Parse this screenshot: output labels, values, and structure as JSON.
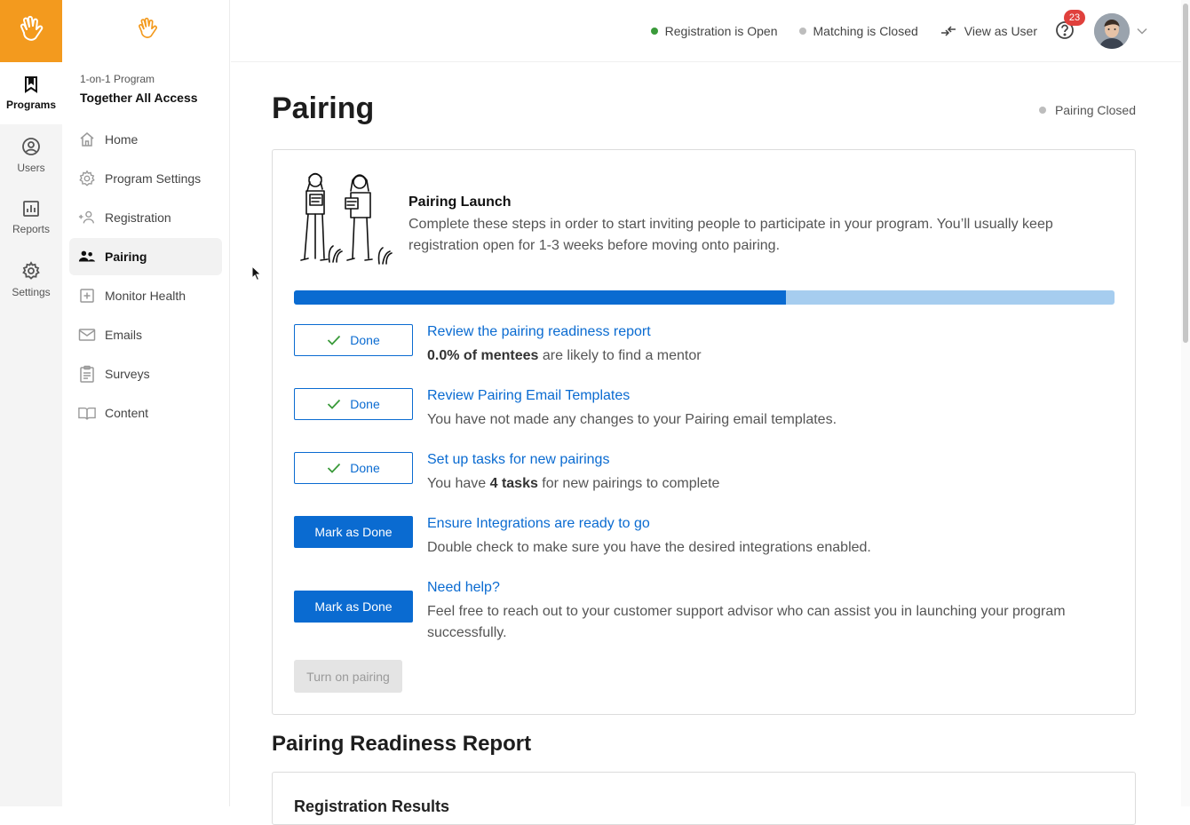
{
  "rail": {
    "items": [
      {
        "label": "Programs",
        "icon": "bookmark-icon",
        "active": true
      },
      {
        "label": "Users",
        "icon": "user-circle-icon"
      },
      {
        "label": "Reports",
        "icon": "bar-chart-icon"
      },
      {
        "label": "Settings",
        "icon": "gear-icon"
      }
    ]
  },
  "program": {
    "kicker": "1-on-1 Program",
    "name": "Together All Access"
  },
  "nav": {
    "items": [
      {
        "label": "Home",
        "icon": "home-icon"
      },
      {
        "label": "Program Settings",
        "icon": "gear-icon"
      },
      {
        "label": "Registration",
        "icon": "add-user-icon"
      },
      {
        "label": "Pairing",
        "icon": "pairing-icon",
        "active": true
      },
      {
        "label": "Monitor Health",
        "icon": "plus-box-icon"
      },
      {
        "label": "Emails",
        "icon": "mail-icon"
      },
      {
        "label": "Surveys",
        "icon": "clipboard-icon"
      },
      {
        "label": "Content",
        "icon": "book-icon"
      }
    ]
  },
  "topbar": {
    "registration": "Registration is Open",
    "matching": "Matching is Closed",
    "view_as_user": "View as User",
    "notification_count": "23"
  },
  "colors": {
    "brand_orange": "#f39a1e",
    "primary_blue": "#0a6bd1",
    "progress_track": "#a6cdef",
    "open_green": "#3a9a3a",
    "closed_gray": "#bdbdbd",
    "badge_red": "#e0403c"
  },
  "page": {
    "title": "Pairing",
    "status": "Pairing Closed"
  },
  "launch": {
    "title": "Pairing Launch",
    "description": "Complete these steps in order to start inviting people to participate in your program. You’ll usually keep registration open for 1-3 weeks before moving onto pairing.",
    "progress_fraction": 0.6
  },
  "steps": [
    {
      "button": "Done",
      "state": "done",
      "link": "Review the pairing readiness report",
      "desc_bold": "0.0% of mentees",
      "desc_rest": " are likely to find a mentor"
    },
    {
      "button": "Done",
      "state": "done",
      "link": "Review Pairing Email Templates",
      "desc_pre": "You have not made any changes to your Pairing email templates."
    },
    {
      "button": "Done",
      "state": "done",
      "link": "Set up tasks for new pairings",
      "desc_pre": "You have ",
      "desc_bold": "4 tasks",
      "desc_rest": " for new pairings to complete"
    },
    {
      "button": "Mark as Done",
      "state": "todo",
      "link": "Ensure Integrations are ready to go",
      "desc_pre": "Double check to make sure you have the desired integrations enabled."
    },
    {
      "button": "Mark as Done",
      "state": "todo",
      "link": "Need help?",
      "desc_pre": "Feel free to reach out to your customer support advisor who can assist you in launching your program successfully."
    }
  ],
  "turn_on_label": "Turn on pairing",
  "report": {
    "title": "Pairing Readiness Report",
    "subtitle": "Registration Results"
  }
}
